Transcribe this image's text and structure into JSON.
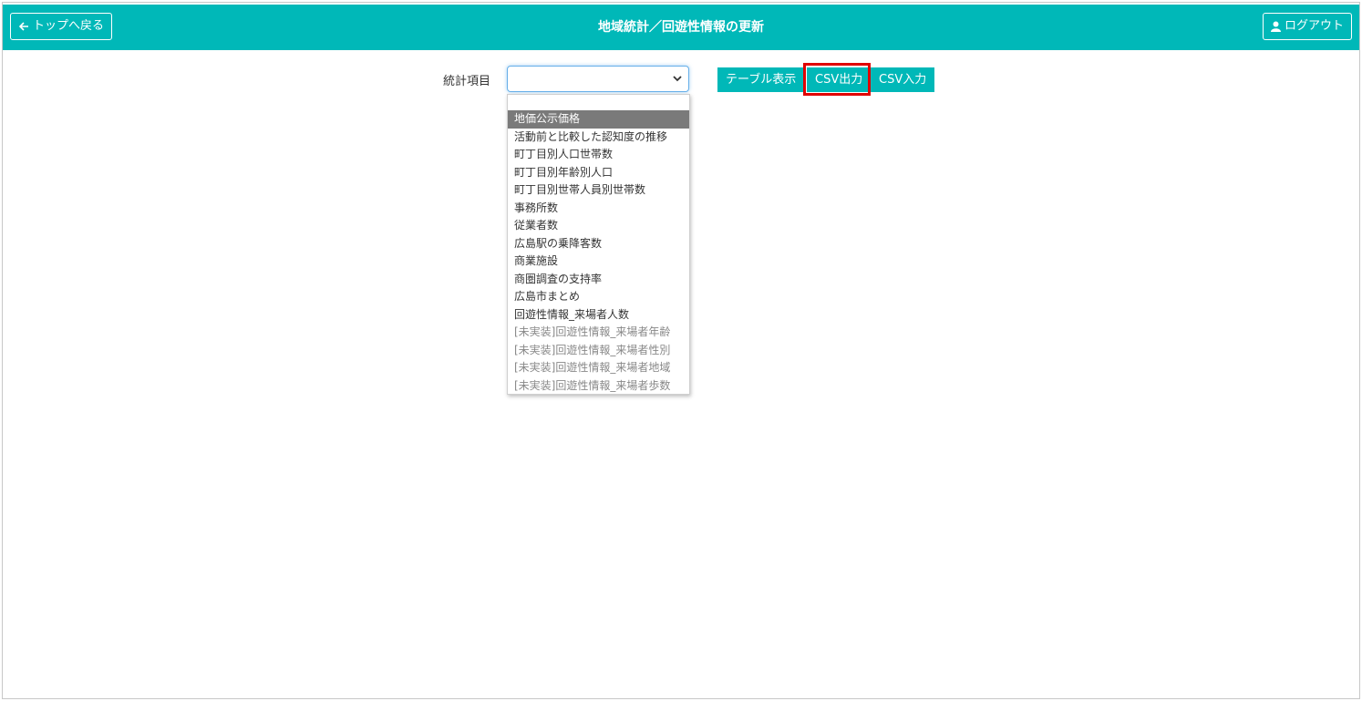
{
  "header": {
    "back_label": "トップへ戻る",
    "title": "地域統計／回遊性情報の更新",
    "logout_label": "ログアウト",
    "bg_color": "#00b8b8"
  },
  "form": {
    "stat_label": "統計項目",
    "select_value": ""
  },
  "buttons": {
    "table_label": "テーブル表示",
    "csv_out_label": "CSV出力",
    "csv_in_label": "CSV入力"
  },
  "dropdown": {
    "options": [
      "地価公示価格",
      "活動前と比較した認知度の推移",
      "町丁目別人口世帯数",
      "町丁目別年齢別人口",
      "町丁目別世帯人員別世帯数",
      "事務所数",
      "従業者数",
      "広島駅の乗降客数",
      "商業施設",
      "商圏調査の支持率",
      "広島市まとめ",
      "回遊性情報_来場者人数",
      "[未実装]回遊性情報_来場者年齢",
      "[未実装]回遊性情報_来場者性別",
      "[未実装]回遊性情報_来場者地域",
      "[未実装]回遊性情報_来場者歩数"
    ],
    "highlighted_option": "地価公示価格"
  },
  "annotation": {
    "highlight_color": "#e00000"
  }
}
